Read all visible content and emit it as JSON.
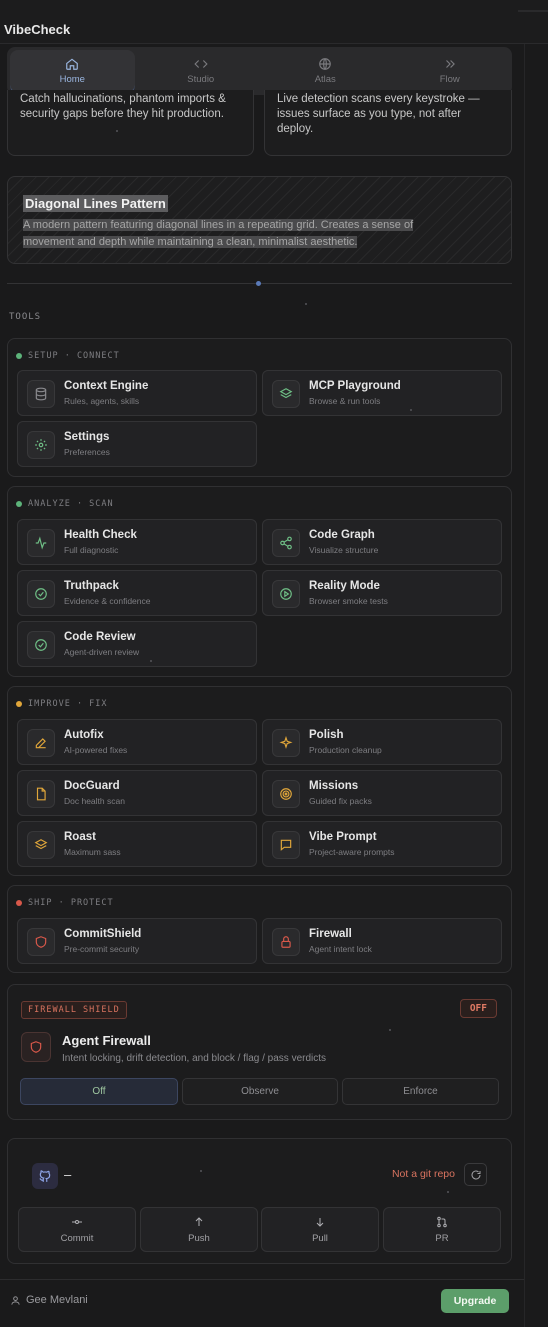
{
  "app": {
    "title": "VibeCheck"
  },
  "nav": [
    {
      "label": "Home",
      "icon": "home-icon"
    },
    {
      "label": "Studio",
      "icon": "code-icon"
    },
    {
      "label": "Atlas",
      "icon": "globe-icon"
    },
    {
      "label": "Flow",
      "icon": "chevrons-right-icon"
    }
  ],
  "cards": {
    "left_text": "Catch hallucinations, phantom imports & security gaps before they hit production.",
    "right_text": "Live detection scans every keystroke — issues surface as you type, not after deploy."
  },
  "pattern": {
    "title": "Diagonal Lines Pattern",
    "description": "A modern pattern featuring diagonal lines in a repeating grid. Creates a sense of movement and depth while maintaining a clean, minimalist aesthetic."
  },
  "tools_label": "TOOLS",
  "sections": {
    "setup": {
      "label": "SETUP · CONNECT",
      "color": "#5db37a",
      "tools": [
        {
          "name": "Context Engine",
          "sub": "Rules, agents, skills",
          "icon": "database-icon"
        },
        {
          "name": "MCP Playground",
          "sub": "Browse & run tools",
          "icon": "layers-icon"
        },
        {
          "name": "Settings",
          "sub": "Preferences",
          "icon": "gear-icon"
        }
      ]
    },
    "analyze": {
      "label": "ANALYZE · SCAN",
      "color": "#5db37a",
      "tools": [
        {
          "name": "Health Check",
          "sub": "Full diagnostic",
          "icon": "activity-icon"
        },
        {
          "name": "Code Graph",
          "sub": "Visualize structure",
          "icon": "share-icon"
        },
        {
          "name": "Truthpack",
          "sub": "Evidence & confidence",
          "icon": "check-circle-icon"
        },
        {
          "name": "Reality Mode",
          "sub": "Browser smoke tests",
          "icon": "play-circle-icon"
        },
        {
          "name": "Code Review",
          "sub": "Agent-driven review",
          "icon": "check-circle-icon"
        }
      ]
    },
    "improve": {
      "label": "IMPROVE · FIX",
      "color": "#e0a63a",
      "tools": [
        {
          "name": "Autofix",
          "sub": "AI-powered fixes",
          "icon": "pencil-icon"
        },
        {
          "name": "Polish",
          "sub": "Production cleanup",
          "icon": "sparkles-icon"
        },
        {
          "name": "DocGuard",
          "sub": "Doc health scan",
          "icon": "file-icon"
        },
        {
          "name": "Missions",
          "sub": "Guided fix packs",
          "icon": "target-icon"
        },
        {
          "name": "Roast",
          "sub": "Maximum sass",
          "icon": "layers-icon"
        },
        {
          "name": "Vibe Prompt",
          "sub": "Project-aware prompts",
          "icon": "message-icon"
        }
      ]
    },
    "ship": {
      "label": "SHIP · PROTECT",
      "color": "#d8584a",
      "tools": [
        {
          "name": "CommitShield",
          "sub": "Pre-commit security",
          "icon": "shield-icon"
        },
        {
          "name": "Firewall",
          "sub": "Agent intent lock",
          "icon": "lock-icon"
        }
      ]
    }
  },
  "firewall": {
    "badge": "FIREWALL SHIELD",
    "state": "OFF",
    "title": "Agent Firewall",
    "subtitle": "Intent locking, drift detection, and block / flag / pass verdicts",
    "modes": [
      "Off",
      "Observe",
      "Enforce"
    ],
    "active_mode": "Off"
  },
  "git": {
    "repo": "–",
    "status": "Not a git repo",
    "actions": [
      {
        "label": "Commit",
        "icon": "commit-icon"
      },
      {
        "label": "Push",
        "icon": "arrow-up-icon"
      },
      {
        "label": "Pull",
        "icon": "arrow-down-icon"
      },
      {
        "label": "PR",
        "icon": "pull-request-icon"
      }
    ]
  },
  "footer": {
    "user": "Gee Mevlani",
    "upgrade": "Upgrade"
  },
  "colors": {
    "accent": "#5a7ab8",
    "upgrade": "#5c9e6a",
    "warn": "#d8735f"
  }
}
